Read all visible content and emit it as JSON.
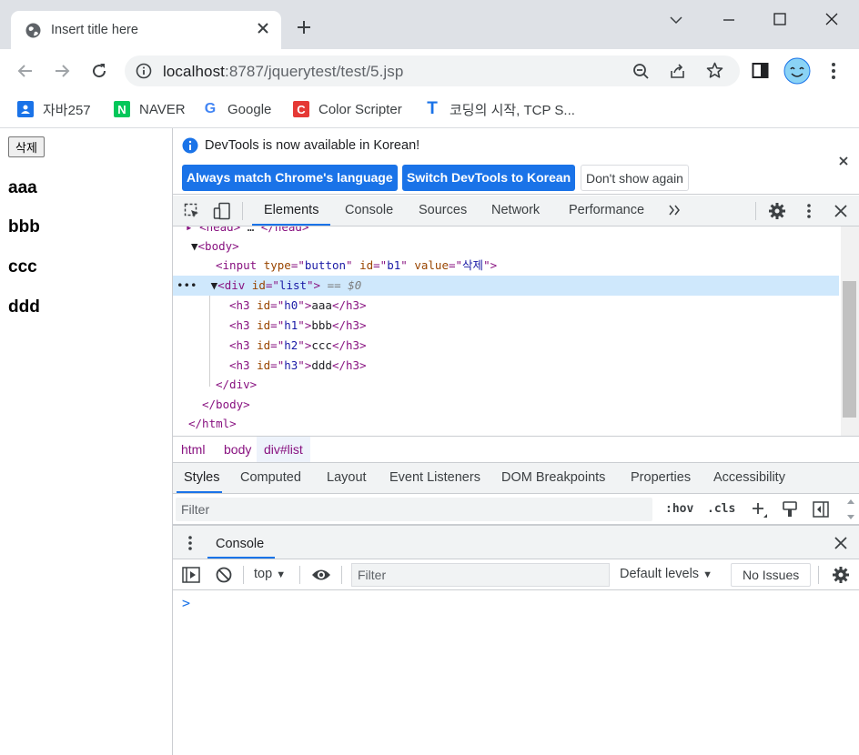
{
  "browser": {
    "tab_title": "Insert title here",
    "url_host": "localhost",
    "url_rest": ":8787/jquerytest/test/5.jsp",
    "bookmarks": [
      {
        "label": "자바257",
        "icon": "contact-icon",
        "color": "#1a73e8"
      },
      {
        "label": "NAVER",
        "icon": "naver-icon",
        "color": "#03c75a"
      },
      {
        "label": "Google",
        "icon": "google-icon",
        "color": "#4285f4"
      },
      {
        "label": "Color Scripter",
        "icon": "colorscripter-icon",
        "color": "#e53935"
      },
      {
        "label": "코딩의 시작, TCP S...",
        "icon": "tcp-school-icon",
        "color": "#1a73e8"
      }
    ]
  },
  "page": {
    "button_label": "삭제",
    "headings": [
      "aaa",
      "bbb",
      "ccc",
      "ddd"
    ]
  },
  "devtools": {
    "info_message": "DevTools is now available in Korean!",
    "info_buttons": [
      "Always match Chrome's language",
      "Switch DevTools to Korean",
      "Don't show again"
    ],
    "main_tabs": [
      "Elements",
      "Console",
      "Sources",
      "Network",
      "Performance"
    ],
    "selected_main_tab": "Elements",
    "dom": {
      "head_line": "<head>",
      "head_close": "</head>",
      "body_open": "<body>",
      "input": {
        "tag": "input",
        "attrs": [
          [
            "type",
            "button"
          ],
          [
            "id",
            "b1"
          ],
          [
            "value",
            "삭제"
          ]
        ]
      },
      "div": {
        "tag": "div",
        "attr": "id",
        "value": "list",
        "marker": "== $0"
      },
      "h3_rows": [
        {
          "id": "h0",
          "text": "aaa"
        },
        {
          "id": "h1",
          "text": "bbb"
        },
        {
          "id": "h2",
          "text": "ccc"
        },
        {
          "id": "h3",
          "text": "ddd"
        }
      ],
      "div_close": "</div>",
      "body_close": "</body>",
      "html_close": "</html>"
    },
    "breadcrumbs": [
      "html",
      "body",
      "div#list"
    ],
    "style_tabs": [
      "Styles",
      "Computed",
      "Layout",
      "Event Listeners",
      "DOM Breakpoints",
      "Properties",
      "Accessibility"
    ],
    "styles_filter_placeholder": "Filter",
    "hov_label": ":hov",
    "cls_label": ".cls",
    "drawer_tab": "Console",
    "console": {
      "context": "top",
      "filter_placeholder": "Filter",
      "levels": "Default levels",
      "issues": "No Issues",
      "prompt": ">"
    },
    "accent": "#1a73e8"
  }
}
